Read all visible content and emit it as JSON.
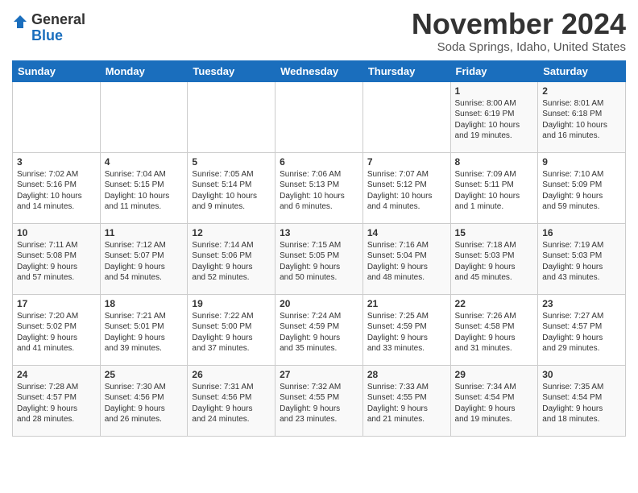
{
  "logo": {
    "general": "General",
    "blue": "Blue"
  },
  "title": "November 2024",
  "subtitle": "Soda Springs, Idaho, United States",
  "days_of_week": [
    "Sunday",
    "Monday",
    "Tuesday",
    "Wednesday",
    "Thursday",
    "Friday",
    "Saturday"
  ],
  "weeks": [
    [
      {
        "day": "",
        "info": ""
      },
      {
        "day": "",
        "info": ""
      },
      {
        "day": "",
        "info": ""
      },
      {
        "day": "",
        "info": ""
      },
      {
        "day": "",
        "info": ""
      },
      {
        "day": "1",
        "info": "Sunrise: 8:00 AM\nSunset: 6:19 PM\nDaylight: 10 hours\nand 19 minutes."
      },
      {
        "day": "2",
        "info": "Sunrise: 8:01 AM\nSunset: 6:18 PM\nDaylight: 10 hours\nand 16 minutes."
      }
    ],
    [
      {
        "day": "3",
        "info": "Sunrise: 7:02 AM\nSunset: 5:16 PM\nDaylight: 10 hours\nand 14 minutes."
      },
      {
        "day": "4",
        "info": "Sunrise: 7:04 AM\nSunset: 5:15 PM\nDaylight: 10 hours\nand 11 minutes."
      },
      {
        "day": "5",
        "info": "Sunrise: 7:05 AM\nSunset: 5:14 PM\nDaylight: 10 hours\nand 9 minutes."
      },
      {
        "day": "6",
        "info": "Sunrise: 7:06 AM\nSunset: 5:13 PM\nDaylight: 10 hours\nand 6 minutes."
      },
      {
        "day": "7",
        "info": "Sunrise: 7:07 AM\nSunset: 5:12 PM\nDaylight: 10 hours\nand 4 minutes."
      },
      {
        "day": "8",
        "info": "Sunrise: 7:09 AM\nSunset: 5:11 PM\nDaylight: 10 hours\nand 1 minute."
      },
      {
        "day": "9",
        "info": "Sunrise: 7:10 AM\nSunset: 5:09 PM\nDaylight: 9 hours\nand 59 minutes."
      }
    ],
    [
      {
        "day": "10",
        "info": "Sunrise: 7:11 AM\nSunset: 5:08 PM\nDaylight: 9 hours\nand 57 minutes."
      },
      {
        "day": "11",
        "info": "Sunrise: 7:12 AM\nSunset: 5:07 PM\nDaylight: 9 hours\nand 54 minutes."
      },
      {
        "day": "12",
        "info": "Sunrise: 7:14 AM\nSunset: 5:06 PM\nDaylight: 9 hours\nand 52 minutes."
      },
      {
        "day": "13",
        "info": "Sunrise: 7:15 AM\nSunset: 5:05 PM\nDaylight: 9 hours\nand 50 minutes."
      },
      {
        "day": "14",
        "info": "Sunrise: 7:16 AM\nSunset: 5:04 PM\nDaylight: 9 hours\nand 48 minutes."
      },
      {
        "day": "15",
        "info": "Sunrise: 7:18 AM\nSunset: 5:03 PM\nDaylight: 9 hours\nand 45 minutes."
      },
      {
        "day": "16",
        "info": "Sunrise: 7:19 AM\nSunset: 5:03 PM\nDaylight: 9 hours\nand 43 minutes."
      }
    ],
    [
      {
        "day": "17",
        "info": "Sunrise: 7:20 AM\nSunset: 5:02 PM\nDaylight: 9 hours\nand 41 minutes."
      },
      {
        "day": "18",
        "info": "Sunrise: 7:21 AM\nSunset: 5:01 PM\nDaylight: 9 hours\nand 39 minutes."
      },
      {
        "day": "19",
        "info": "Sunrise: 7:22 AM\nSunset: 5:00 PM\nDaylight: 9 hours\nand 37 minutes."
      },
      {
        "day": "20",
        "info": "Sunrise: 7:24 AM\nSunset: 4:59 PM\nDaylight: 9 hours\nand 35 minutes."
      },
      {
        "day": "21",
        "info": "Sunrise: 7:25 AM\nSunset: 4:59 PM\nDaylight: 9 hours\nand 33 minutes."
      },
      {
        "day": "22",
        "info": "Sunrise: 7:26 AM\nSunset: 4:58 PM\nDaylight: 9 hours\nand 31 minutes."
      },
      {
        "day": "23",
        "info": "Sunrise: 7:27 AM\nSunset: 4:57 PM\nDaylight: 9 hours\nand 29 minutes."
      }
    ],
    [
      {
        "day": "24",
        "info": "Sunrise: 7:28 AM\nSunset: 4:57 PM\nDaylight: 9 hours\nand 28 minutes."
      },
      {
        "day": "25",
        "info": "Sunrise: 7:30 AM\nSunset: 4:56 PM\nDaylight: 9 hours\nand 26 minutes."
      },
      {
        "day": "26",
        "info": "Sunrise: 7:31 AM\nSunset: 4:56 PM\nDaylight: 9 hours\nand 24 minutes."
      },
      {
        "day": "27",
        "info": "Sunrise: 7:32 AM\nSunset: 4:55 PM\nDaylight: 9 hours\nand 23 minutes."
      },
      {
        "day": "28",
        "info": "Sunrise: 7:33 AM\nSunset: 4:55 PM\nDaylight: 9 hours\nand 21 minutes."
      },
      {
        "day": "29",
        "info": "Sunrise: 7:34 AM\nSunset: 4:54 PM\nDaylight: 9 hours\nand 19 minutes."
      },
      {
        "day": "30",
        "info": "Sunrise: 7:35 AM\nSunset: 4:54 PM\nDaylight: 9 hours\nand 18 minutes."
      }
    ]
  ]
}
